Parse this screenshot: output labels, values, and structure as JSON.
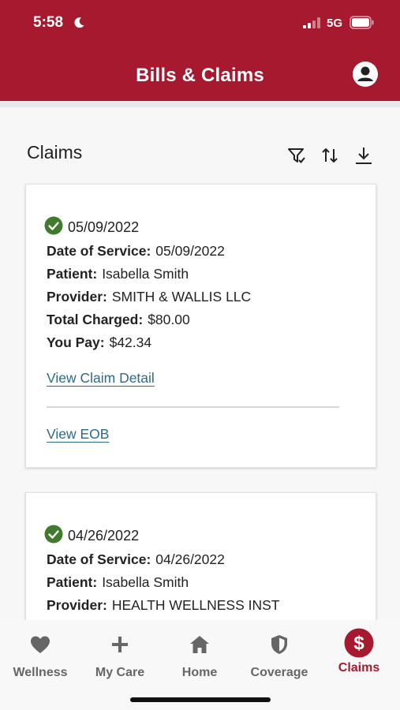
{
  "status": {
    "time": "5:58",
    "network": "5G"
  },
  "header": {
    "title": "Bills & Claims"
  },
  "section": {
    "title": "Claims"
  },
  "claims": [
    {
      "date": "05/09/2022",
      "date_of_service_label": "Date of Service:",
      "date_of_service": "05/09/2022",
      "patient_label": "Patient:",
      "patient": "Isabella Smith",
      "provider_label": "Provider:",
      "provider": "SMITH & WALLIS LLC",
      "total_charged_label": "Total Charged:",
      "total_charged": "$80.00",
      "you_pay_label": "You Pay:",
      "you_pay": "$42.34",
      "view_detail": "View Claim Detail",
      "view_eob": "View EOB"
    },
    {
      "date": "04/26/2022",
      "date_of_service_label": "Date of Service:",
      "date_of_service": "04/26/2022",
      "patient_label": "Patient:",
      "patient": "Isabella Smith",
      "provider_label": "Provider:",
      "provider": "HEALTH WELLNESS INST"
    }
  ],
  "nav": [
    {
      "label": "Wellness",
      "icon": "heart-icon"
    },
    {
      "label": "My Care",
      "icon": "plus-icon"
    },
    {
      "label": "Home",
      "icon": "home-icon"
    },
    {
      "label": "Coverage",
      "icon": "shield-icon"
    },
    {
      "label": "Claims",
      "icon": "dollar-icon"
    }
  ],
  "colors": {
    "brand": "#a6192e",
    "link": "#2d6a8a",
    "success": "#3f7a2e",
    "inactive_nav": "#666666"
  }
}
